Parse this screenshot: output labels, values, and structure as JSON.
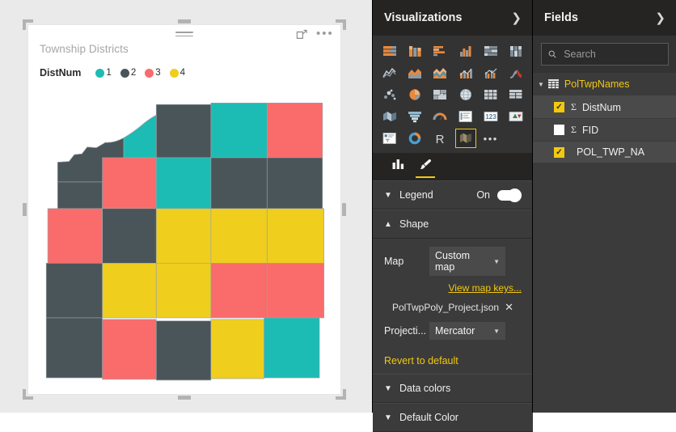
{
  "visual": {
    "title": "Township Districts",
    "drag_handle_icon": "drag-handle-icon",
    "focus_icon": "focus-mode-icon",
    "more_icon": "more-options-icon",
    "legend": {
      "title": "DistNum",
      "items": [
        {
          "label": "1",
          "color": "#1CBCB4"
        },
        {
          "label": "2",
          "color": "#4A555A"
        },
        {
          "label": "3",
          "color": "#FA6B6B"
        },
        {
          "label": "4",
          "color": "#EFCE1E"
        }
      ]
    }
  },
  "chart_data": {
    "type": "map",
    "title": "Township Districts",
    "legend_title": "DistNum",
    "legend_position": "top",
    "categories": [
      "1",
      "2",
      "3",
      "4"
    ],
    "colors": [
      "#1CBCB4",
      "#4A555A",
      "#FA6B6B",
      "#EFCE1E"
    ],
    "grid_rows": 5,
    "grid_cols": 5,
    "cells": [
      [
        null,
        "1",
        "2",
        "1",
        "3"
      ],
      [
        "2",
        "3",
        "1",
        "2",
        "2"
      ],
      [
        "3",
        "2",
        "4",
        "4",
        "4"
      ],
      [
        "2",
        "4",
        "4",
        "3",
        "3"
      ],
      [
        "2",
        "3",
        "2",
        "4",
        "1"
      ]
    ]
  },
  "visualizations": {
    "header": "Visualizations",
    "chevron_icon": "chevron-right-icon",
    "gallery": [
      [
        "stacked-bar-chart-icon",
        "stacked-column-chart-icon",
        "clustered-bar-chart-icon",
        "clustered-column-chart-icon",
        "percent-stacked-bar-chart-icon",
        "percent-stacked-column-chart-icon"
      ],
      [
        "line-chart-icon",
        "area-chart-icon",
        "stacked-area-chart-icon",
        "line-stacked-column-chart-icon",
        "line-clustered-column-chart-icon",
        "ribbon-chart-icon"
      ],
      [
        "scatter-chart-icon",
        "pie-chart-icon",
        "treemap-icon",
        "globe-map-icon",
        "matrix-icon",
        "table-icon"
      ],
      [
        "filled-map-icon",
        "funnel-chart-icon",
        "gauge-chart-icon",
        "multi-row-card-icon",
        "card-icon",
        "kpi-icon"
      ],
      [
        "slicer-icon",
        "donut-chart-icon",
        "r-script-visual-icon",
        "shape-map-icon",
        "more-visuals-icon"
      ]
    ],
    "selected_visual": "shape-map-icon",
    "format_tabs": [
      {
        "icon": "fields-pane-icon",
        "active": false
      },
      {
        "icon": "format-paint-icon",
        "active": true
      }
    ],
    "sections": {
      "legend": {
        "label": "Legend",
        "caret": "chevron-down-icon",
        "toggle_state": "On"
      },
      "shape": {
        "label": "Shape",
        "caret": "chevron-up-icon",
        "map_label": "Map",
        "map_value": "Custom map",
        "view_map_keys": "View map keys...",
        "file_name": "PolTwpPoly_Project.json",
        "remove_icon": "close-icon",
        "projection_label": "Projecti...",
        "projection_value": "Mercator"
      },
      "revert": "Revert to default",
      "data_colors": {
        "label": "Data colors",
        "caret": "chevron-down-icon"
      },
      "default_color": {
        "label": "Default Color",
        "caret": "chevron-down-icon"
      }
    }
  },
  "fields": {
    "header": "Fields",
    "chevron_icon": "chevron-right-icon",
    "search_placeholder": "Search",
    "search_value": "",
    "search_icon": "search-icon",
    "table": {
      "name": "PolTwpNames",
      "icon": "table-icon",
      "caret": "chevron-down-icon",
      "items": [
        {
          "name": "DistNum",
          "checked": true,
          "aggregate": "Σ"
        },
        {
          "name": "FID",
          "checked": false,
          "aggregate": "Σ"
        },
        {
          "name": "POL_TWP_NA",
          "checked": true,
          "aggregate": ""
        }
      ]
    }
  }
}
